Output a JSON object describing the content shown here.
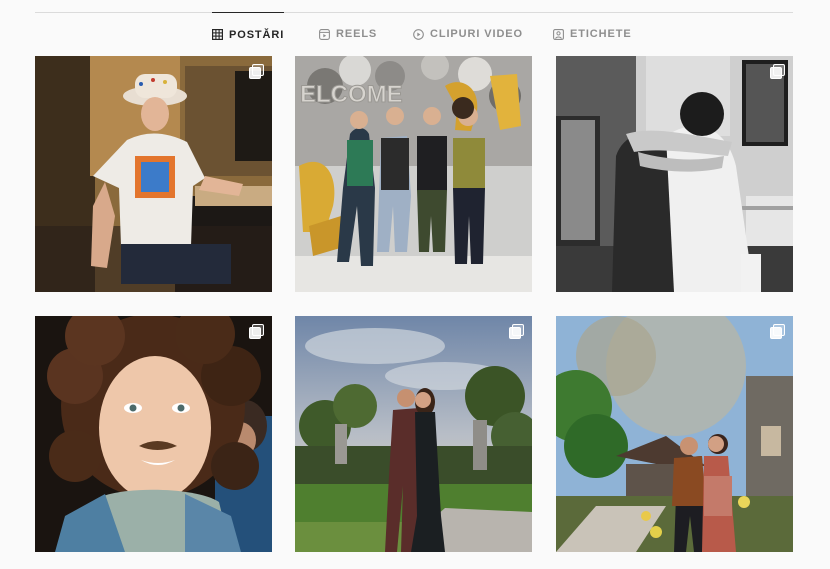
{
  "tabs": [
    {
      "label": "POSTĂRI",
      "icon": "grid-icon",
      "active": true
    },
    {
      "label": "REELS",
      "icon": "reels-icon",
      "active": false
    },
    {
      "label": "CLIPURI VIDEO",
      "icon": "video-icon",
      "active": false
    },
    {
      "label": "ETICHETE",
      "icon": "tagged-icon",
      "active": false
    }
  ],
  "posts": [
    {
      "subject": "man-in-cowboy-hat-on-tour-bus",
      "multi": true
    },
    {
      "subject": "group-with-gold-balloons",
      "multi": false
    },
    {
      "subject": "black-and-white-hug",
      "multi": true
    },
    {
      "subject": "curly-hair-closeup-portrait",
      "multi": true
    },
    {
      "subject": "couple-in-park-at-sunset",
      "multi": true
    },
    {
      "subject": "couple-in-spring-garden",
      "multi": true
    }
  ],
  "colors": {
    "active_tab": "#262626",
    "inactive_tab": "#8e8e8e",
    "divider": "#dbdbdb",
    "background": "#fafafa"
  }
}
